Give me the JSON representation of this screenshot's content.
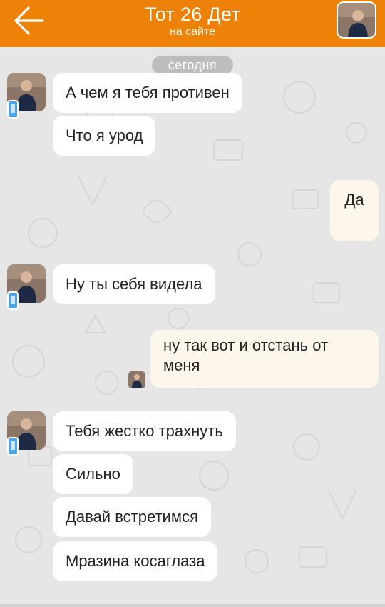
{
  "header": {
    "title": "Тот 26 Дет",
    "status": "на сайте",
    "back_icon": "arrow-left-icon",
    "avatar_icon": "user-avatar-photo",
    "bg_color": "#ee8208"
  },
  "chat": {
    "date_separator": "сегодня",
    "messages": [
      {
        "from": "contact",
        "text": "А чем я тебя противен"
      },
      {
        "from": "contact",
        "text": "Что я урод"
      },
      {
        "from": "me",
        "text": "Да"
      },
      {
        "from": "contact",
        "text": "Ну ты себя видела"
      },
      {
        "from": "me",
        "text": "ну так вот и отстань от меня"
      },
      {
        "from": "contact",
        "text": "Тебя жестко трахнуть"
      },
      {
        "from": "contact",
        "text": "Сильно"
      },
      {
        "from": "contact",
        "text": "Давай встретимся"
      },
      {
        "from": "contact",
        "text": "Мразина косаглаза"
      }
    ],
    "incoming_color": "#ffffff",
    "outgoing_color": "#fdf6ea",
    "mobile_badge_icon": "mobile-phone-icon"
  }
}
